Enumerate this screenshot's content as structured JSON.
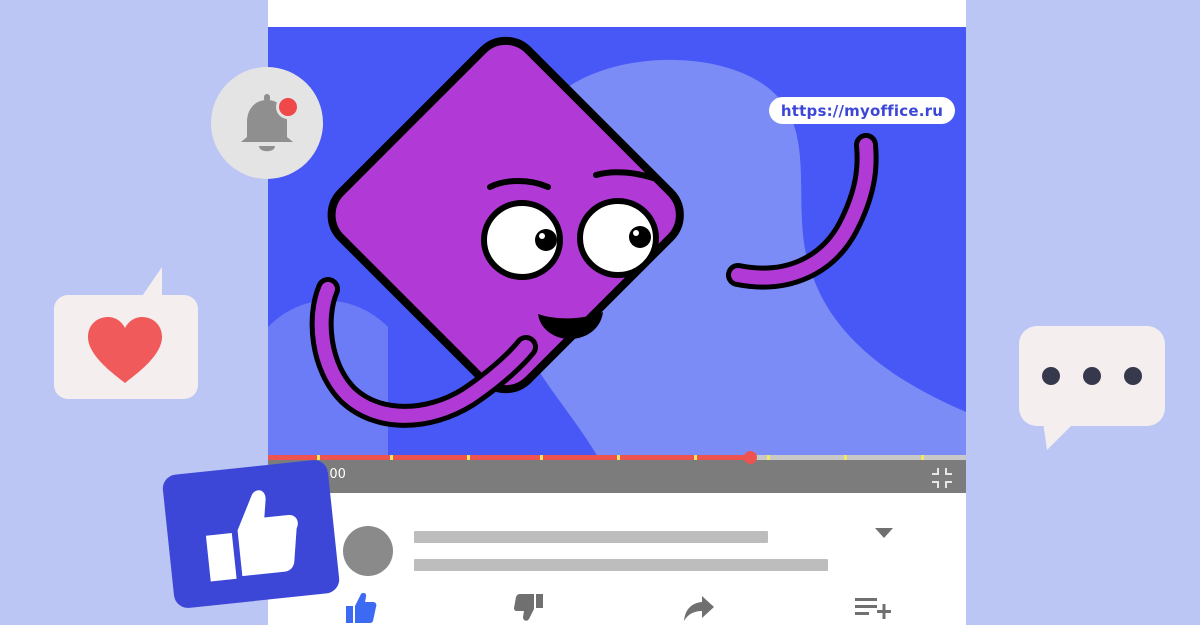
{
  "overlay": {
    "url": "https://myoffice.ru"
  },
  "player": {
    "time_text": ":00",
    "progress_fraction": 0.69,
    "chapter_markers_fraction": [
      0.07,
      0.175,
      0.285,
      0.39,
      0.5,
      0.61,
      0.715,
      0.825,
      0.935
    ]
  },
  "icons": {
    "bell": "bell-icon",
    "heart_bubble": "heart-speech-bubble-icon",
    "thumbs_up_badge": "thumbs-up-badge-icon",
    "chat_bubble": "ellipsis-speech-bubble-icon",
    "exit_fullscreen": "exit-fullscreen-icon",
    "expand": "chevron-down-icon",
    "like": "thumbs-up-icon",
    "dislike": "thumbs-down-icon",
    "share": "share-arrow-icon",
    "save": "add-to-playlist-icon"
  },
  "colors": {
    "background": "#bcc6f5",
    "video_bg": "#4858f6",
    "character": "#b13ad6",
    "accent_red": "#ef5350",
    "brand_blue": "#3c47d8"
  }
}
